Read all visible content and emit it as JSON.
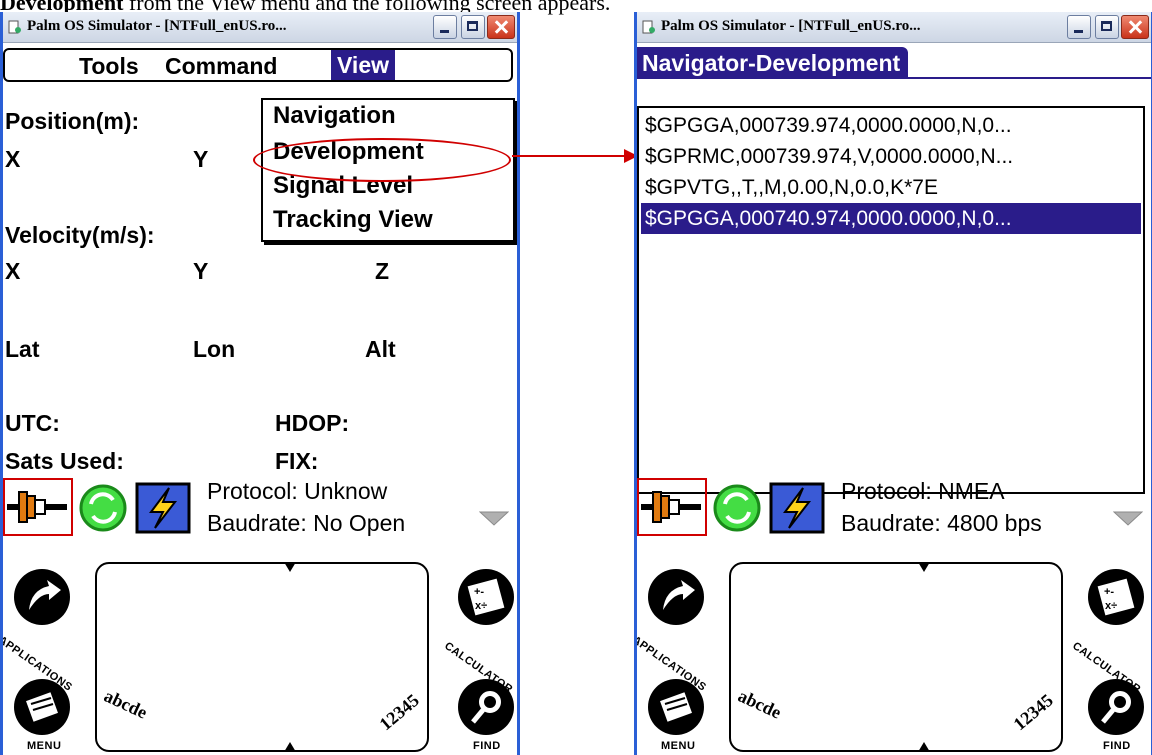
{
  "caption": {
    "bold": "Development",
    "rest": " from the View menu and the following screen appears."
  },
  "window_title": "Palm OS Simulator - [NTFull_enUS.ro...",
  "left": {
    "menubar": {
      "tools": "Tools",
      "command": "Command",
      "view": "View"
    },
    "view_menu": [
      "Navigation",
      "Development",
      "Signal Level",
      "Tracking View"
    ],
    "labels": {
      "position": "Position(m):",
      "x1": "X",
      "y1": "Y",
      "velocity": "Velocity(m/s):",
      "x2": "X",
      "y2": "Y",
      "z2": "Z",
      "lat": "Lat",
      "lon": "Lon",
      "alt": "Alt",
      "utc": "UTC:",
      "hdop": "HDOP:",
      "sats": "Sats Used:",
      "fix": "FIX:"
    },
    "status": {
      "protocol": "Protocol:  Unknow",
      "baudrate": "Baudrate: No Open"
    }
  },
  "right": {
    "form_title": "Navigator-Development",
    "nmea_lines": [
      "$GPGGA,000739.974,0000.0000,N,0...",
      "$GPRMC,000739.974,V,0000.0000,N...",
      "$GPVTG,,T,,M,0.00,N,0.0,K*7E",
      "$GPGGA,000740.974,0000.0000,N,0..."
    ],
    "selected_index": 3,
    "status": {
      "protocol": "Protocol:  NMEA",
      "baudrate": "Baudrate: 4800 bps"
    }
  },
  "silkscreen": {
    "applications": "APPLICATIONS",
    "menu": "MENU",
    "calculator": "CALCULATOR",
    "find": "FIND",
    "abc": "abcde",
    "num": "12345"
  },
  "colors": {
    "accent": "#2a1c8a",
    "highlight": "#d00000"
  }
}
